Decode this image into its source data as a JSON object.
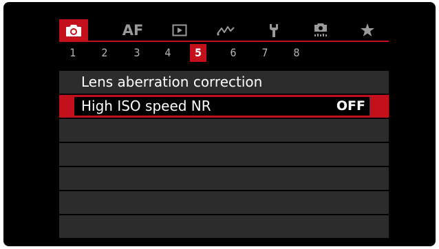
{
  "tabs": [
    {
      "name": "shooting",
      "text": "",
      "icon": "camera-icon",
      "active": true
    },
    {
      "name": "af",
      "text": "AF",
      "icon": "",
      "active": false
    },
    {
      "name": "playback",
      "text": "",
      "icon": "playback-icon",
      "active": false
    },
    {
      "name": "network",
      "text": "",
      "icon": "wireless-icon",
      "active": false
    },
    {
      "name": "setup",
      "text": "",
      "icon": "wrench-icon",
      "active": false
    },
    {
      "name": "custom",
      "text": "",
      "icon": "custom-camera-icon",
      "active": false
    },
    {
      "name": "mymenu",
      "text": "",
      "icon": "star-icon",
      "active": false
    }
  ],
  "pages": [
    "1",
    "2",
    "3",
    "4",
    "5",
    "6",
    "7",
    "8"
  ],
  "active_page": "5",
  "menu_items": [
    {
      "label": "Lens aberration correction",
      "value": "",
      "selected": false
    },
    {
      "label": "High ISO speed NR",
      "value": "OFF",
      "selected": true
    },
    {
      "label": "",
      "value": "",
      "selected": false
    },
    {
      "label": "",
      "value": "",
      "selected": false
    },
    {
      "label": "",
      "value": "",
      "selected": false
    },
    {
      "label": "",
      "value": "",
      "selected": false
    },
    {
      "label": "",
      "value": "",
      "selected": false
    }
  ],
  "colors": {
    "accent": "#c4101d",
    "background": "#000000",
    "row": "#2c2c2c",
    "inactive_icon": "#9a9a9a"
  }
}
